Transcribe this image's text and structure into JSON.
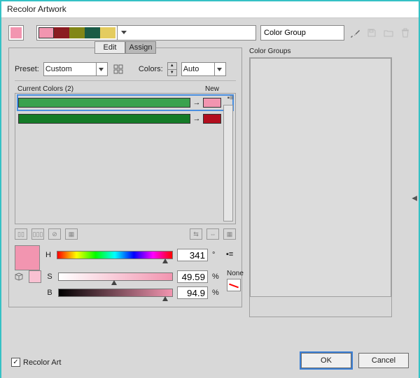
{
  "window": {
    "title": "Recolor Artwork"
  },
  "top": {
    "group_name": "Color Group",
    "harmony_colors": [
      "#f295b0",
      "#8b1c21",
      "#828717",
      "#1b5b46",
      "#e4cc5f"
    ]
  },
  "tabs": {
    "edit": "Edit",
    "assign": "Assign"
  },
  "preset": {
    "label": "Preset:",
    "value": "Custom",
    "colors_label": "Colors:",
    "colors_value": "Auto"
  },
  "current": {
    "header": "Current Colors (2)",
    "new_label": "New",
    "rows": [
      {
        "old": "#3aa24e",
        "new": "#f295b0",
        "selected": true
      },
      {
        "old": "#147b27",
        "new": "#b30e1e",
        "selected": false
      }
    ]
  },
  "none_label": "None",
  "hsb": {
    "h_label": "H",
    "h_value": "341",
    "h_unit": "°",
    "s_label": "S",
    "s_value": "49.59",
    "s_unit": "%",
    "b_label": "B",
    "b_value": "94.9",
    "b_unit": "%"
  },
  "color_groups": {
    "label": "Color Groups"
  },
  "recolor_art": {
    "label": "Recolor Art",
    "checked": true
  },
  "buttons": {
    "ok": "OK",
    "cancel": "Cancel"
  }
}
